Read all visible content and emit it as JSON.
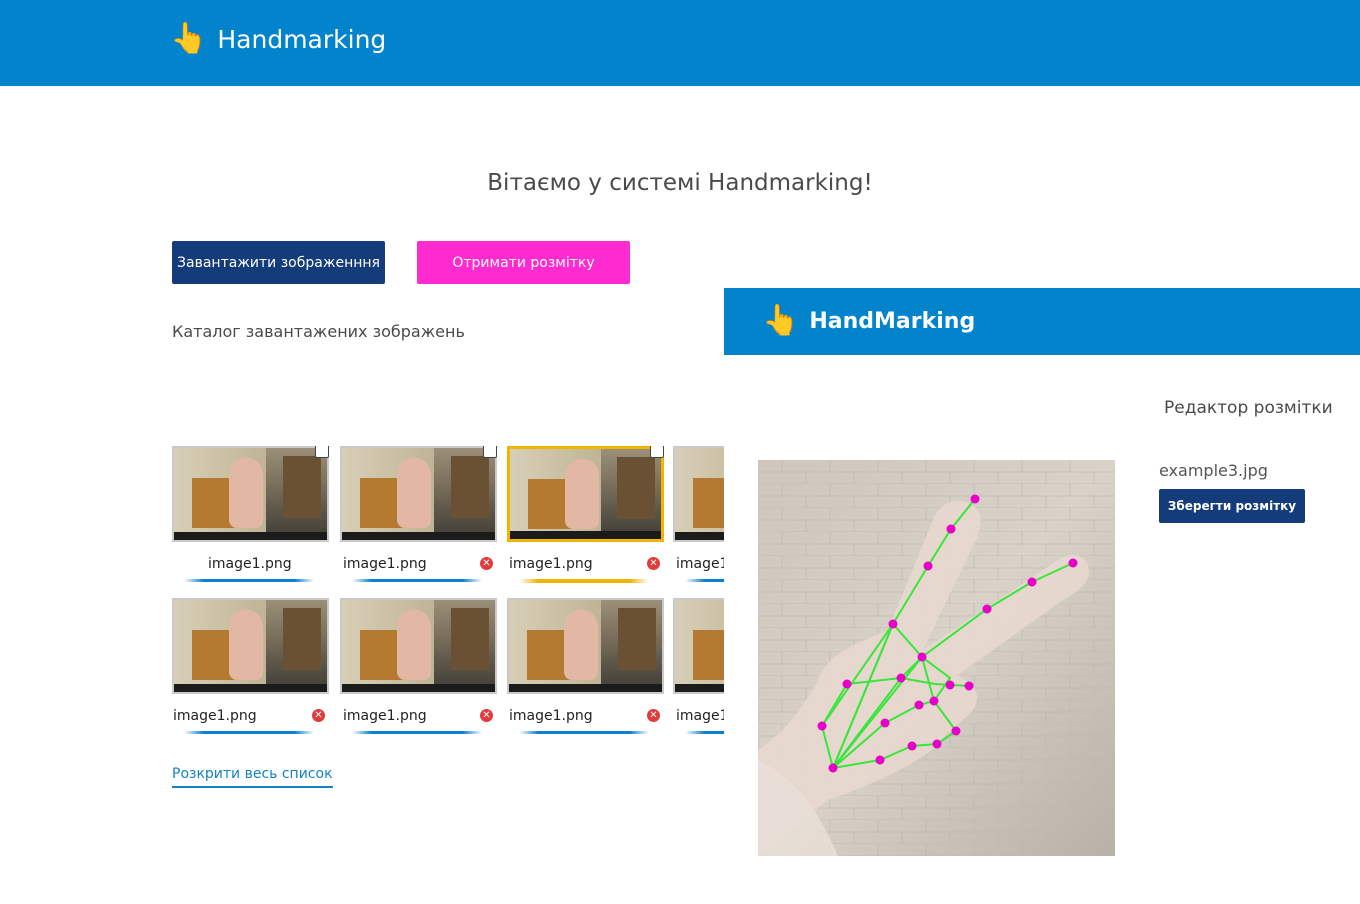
{
  "header": {
    "app_name": "Handmarking",
    "logo_icon": "pointing-hand-icon"
  },
  "main": {
    "welcome": "Вітаємо у системі Handmarking!",
    "upload_button": "Завантажити зображенння",
    "markup_button": "Отримати розмітку",
    "catalog_title": "Каталог завантажених зображень",
    "expand_link": "Розкрити весь список",
    "thumbnails": [
      {
        "name": "image1.png",
        "selected": false,
        "checkbox": true,
        "delete": false
      },
      {
        "name": "image1.png",
        "selected": false,
        "checkbox": true,
        "delete": true
      },
      {
        "name": "image1.png",
        "selected": true,
        "checkbox": true,
        "delete": true
      },
      {
        "name": "image1",
        "selected": false,
        "checkbox": false,
        "delete": false
      },
      {
        "name": "image1.png",
        "selected": false,
        "checkbox": false,
        "delete": true
      },
      {
        "name": "image1.png",
        "selected": false,
        "checkbox": false,
        "delete": true
      },
      {
        "name": "image1.png",
        "selected": false,
        "checkbox": false,
        "delete": true
      },
      {
        "name": "image1",
        "selected": false,
        "checkbox": false,
        "delete": false
      }
    ]
  },
  "editor": {
    "app_name": "HandMarking",
    "title": "Редактор розмітки",
    "filename": "example3.jpg",
    "save_button": "Зберегти розмітку"
  },
  "colors": {
    "header_blue": "#0284cc",
    "button_navy": "#143b7a",
    "button_pink": "#ff2bd0",
    "selection_yellow": "#f0b500",
    "keypoint": "#e600c8",
    "skeleton": "#39e639",
    "link_blue": "#1383c4"
  }
}
